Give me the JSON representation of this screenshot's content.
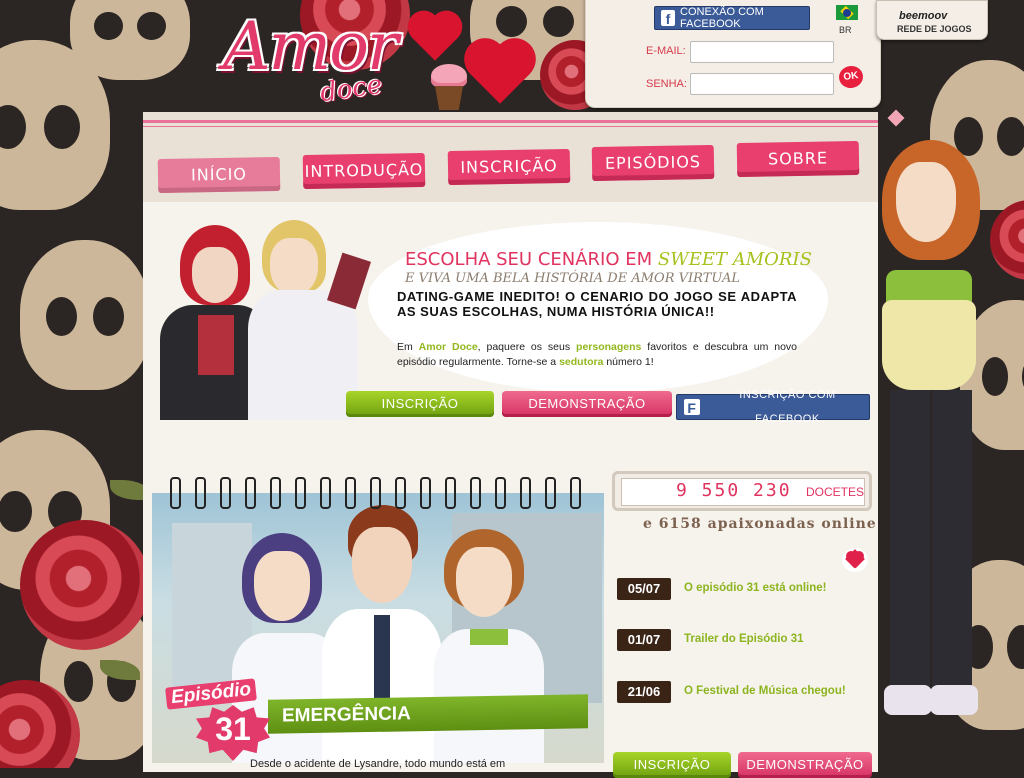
{
  "header": {
    "logo_main": "Amor",
    "logo_sub": "doce"
  },
  "login": {
    "facebook_connect": "CONEXÃO COM FACEBOOK",
    "email_label": "E-MAIL:",
    "email_value": "",
    "password_label": "SENHA:",
    "password_value": "",
    "ok_label": "OK",
    "language": "BR"
  },
  "network": {
    "brand": "beemoov",
    "label": "REDE DE JOGOS"
  },
  "nav": {
    "items": [
      {
        "label": "Início"
      },
      {
        "label": "Introdução"
      },
      {
        "label": "Inscrição"
      },
      {
        "label": "Episódios"
      },
      {
        "label": "Sobre"
      }
    ]
  },
  "hero": {
    "title_prefix": "ESCOLHA SEU CENÁRIO EM",
    "title_game": "SWEET AMORIS",
    "subtitle": "E VIVA UMA BELA HISTÓRIA DE AMOR VIRTUAL",
    "bold_text": "DATING-GAME INEDITO! O CENARIO DO JOGO SE ADAPTA AS SUAS ESCOLHAS, NUMA HISTÓRIA ÚNICA!!",
    "para_1": "Em",
    "para_brand": "Amor Doce",
    "para_2": ", paquere os seus",
    "para_link1": "personagens",
    "para_3": "favoritos e descubra um novo episódio regularmente. Torne-se a",
    "para_link2": "sedutora",
    "para_4": "número 1!",
    "btn_signup": "INSCRIÇÃO",
    "btn_demo": "DEMONSTRAÇÃO",
    "btn_facebook": "INSCRIÇÃO COM FACEBOOK"
  },
  "episode": {
    "word": "Episódio",
    "number": "31",
    "title": "EMERGÊNCIA",
    "teaser": "Desde o acidente de Lysandre, todo mundo está em"
  },
  "stats": {
    "count": "9 550 230",
    "unit": "DOCETES",
    "online": "e 6158 apaixonadas online"
  },
  "news": [
    {
      "date": "05/07",
      "title": "O episódio 31 está online!"
    },
    {
      "date": "01/07",
      "title": "Trailer do Episódio 31"
    },
    {
      "date": "21/06",
      "title": "O Festival de Música chegou!"
    }
  ],
  "side_buttons": {
    "signup": "INSCRIÇÃO",
    "demo": "DEMONSTRAÇÃO"
  },
  "colors": {
    "pink": "#e83f6e",
    "green": "#8cb51f",
    "facebook": "#3a5a98",
    "dark_brown": "#3a2416"
  }
}
